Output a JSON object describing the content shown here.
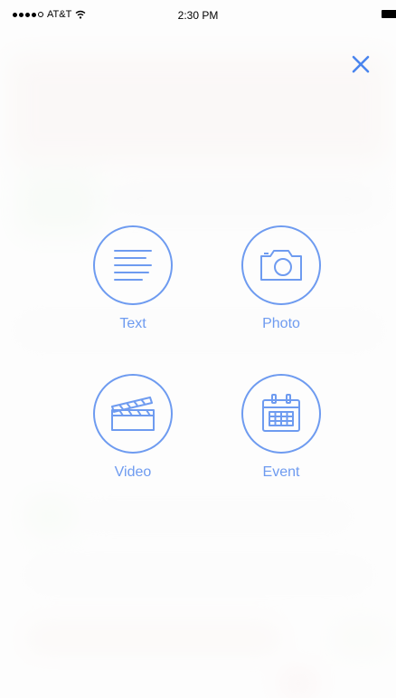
{
  "status_bar": {
    "carrier": "AT&T",
    "time": "2:30 PM"
  },
  "close": {
    "icon": "close-icon"
  },
  "options": [
    {
      "label": "Text",
      "icon": "text-lines-icon"
    },
    {
      "label": "Photo",
      "icon": "camera-icon"
    },
    {
      "label": "Video",
      "icon": "clapperboard-icon"
    },
    {
      "label": "Event",
      "icon": "calendar-icon"
    }
  ],
  "colors": {
    "accent": "#6e9bf0"
  }
}
